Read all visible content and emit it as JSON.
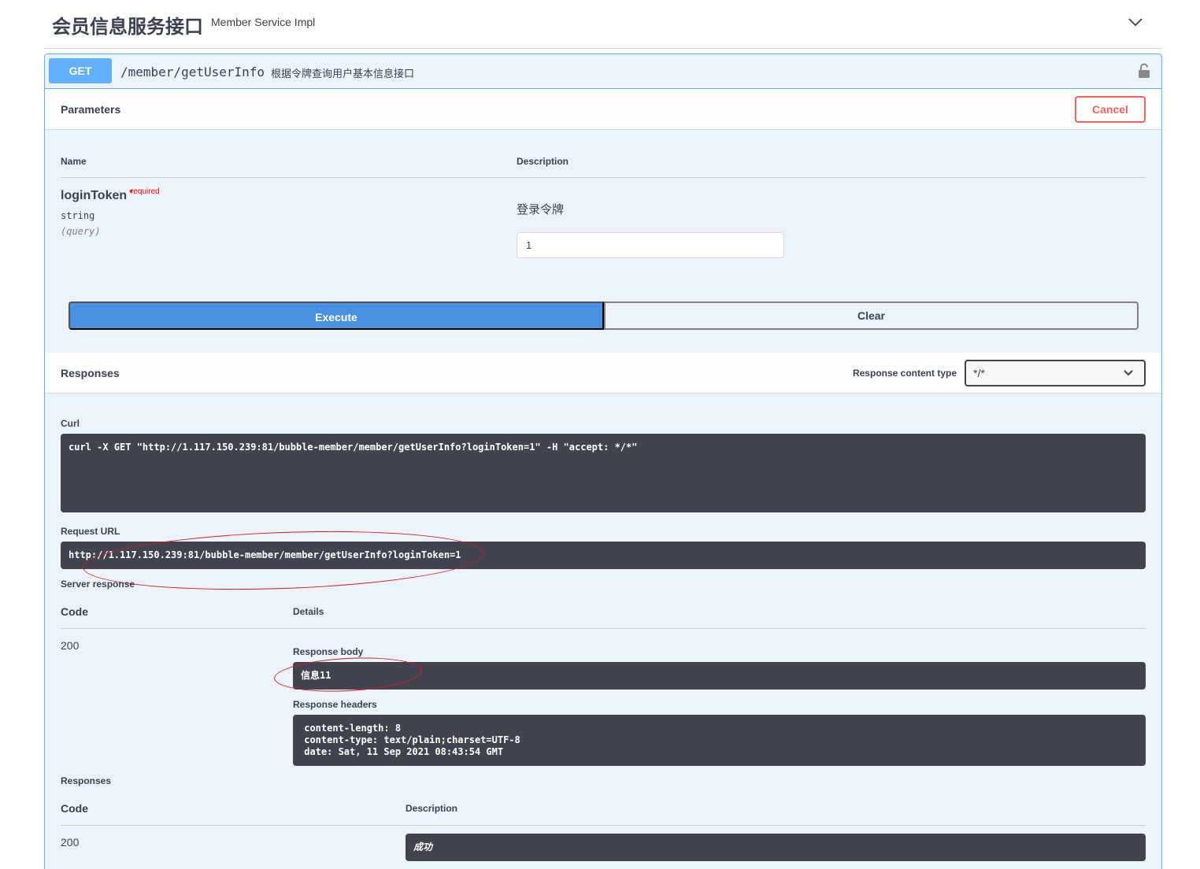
{
  "tag": {
    "title": "会员信息服务接口",
    "description": "Member Service Impl"
  },
  "operation": {
    "method": "GET",
    "path": "/member/getUserInfo",
    "summary": "根据令牌查询用户基本信息接口"
  },
  "parameters": {
    "title": "Parameters",
    "cancel_label": "Cancel",
    "col_name": "Name",
    "col_description": "Description",
    "items": [
      {
        "name": "loginToken",
        "star": "*",
        "required_label": "required",
        "type": "string",
        "in": "(query)",
        "description": "登录令牌",
        "value": "1"
      }
    ]
  },
  "actions": {
    "execute_label": "Execute",
    "clear_label": "Clear"
  },
  "responses_header": {
    "title": "Responses",
    "content_type_label": "Response content type",
    "content_type_value": "*/*"
  },
  "result": {
    "curl_label": "Curl",
    "curl": "curl -X GET \"http://1.117.150.239:81/bubble-member/member/getUserInfo?loginToken=1\" -H \"accept: */*\"",
    "request_url_label": "Request URL",
    "request_url": "http://1.117.150.239:81/bubble-member/member/getUserInfo?loginToken=1",
    "server_response_label": "Server response",
    "col_code": "Code",
    "col_details": "Details",
    "code": "200",
    "response_body_label": "Response body",
    "response_body": "信息11",
    "response_headers_label": "Response headers",
    "response_headers": " content-length: 8 \n content-type: text/plain;charset=UTF-8 \n date: Sat, 11 Sep 2021 08:43:54 GMT "
  },
  "documented_responses": {
    "title": "Responses",
    "col_code": "Code",
    "col_description": "Description",
    "code": "200",
    "description": "成功"
  },
  "colors": {
    "get_blue": "#61affe",
    "execute_blue": "#4990e2",
    "cancel_red": "#ff6060",
    "code_bg": "#41444e",
    "annotation_red": "#d41c1c"
  }
}
